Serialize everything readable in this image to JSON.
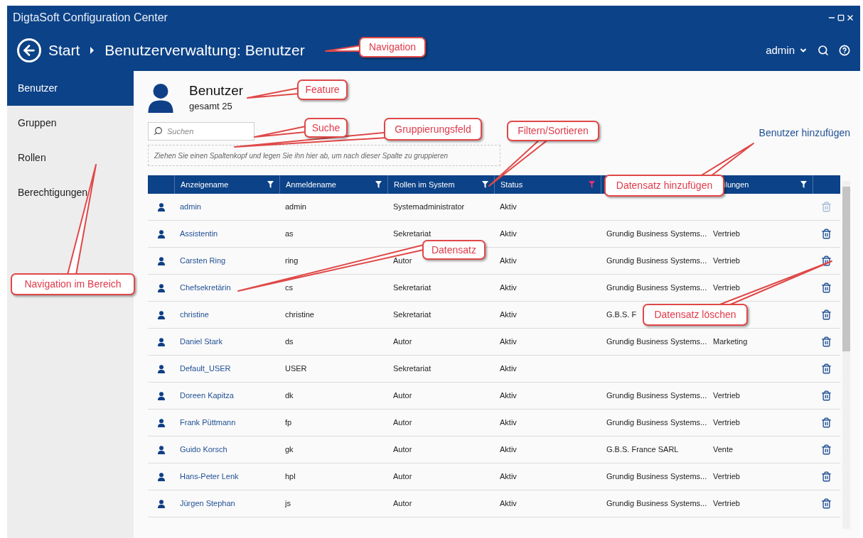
{
  "window": {
    "title": "DigtaSoft Configuration Center"
  },
  "breadcrumb": [
    "Start",
    "Benutzerverwaltung: Benutzer"
  ],
  "user_menu": {
    "label": "admin"
  },
  "sidebar": {
    "items": [
      {
        "label": "Benutzer",
        "selected": true
      },
      {
        "label": "Gruppen",
        "selected": false
      },
      {
        "label": "Rollen",
        "selected": false
      },
      {
        "label": "Berechtigungen",
        "selected": false
      }
    ]
  },
  "feature": {
    "title": "Benutzer",
    "subtitle": "gesamt 25"
  },
  "search": {
    "placeholder": "Suchen"
  },
  "add_link": "Benutzer hinzufügen",
  "group_area": {
    "placeholder": "Ziehen Sie einen Spaltenkopf und legen Sie ihn hier ab, um nach dieser Spalte zu gruppieren"
  },
  "table": {
    "columns": [
      {
        "label": "Anzeigename",
        "filter_active": false
      },
      {
        "label": "Anmeldename",
        "filter_active": false
      },
      {
        "label": "Rollen im System",
        "filter_active": false
      },
      {
        "label": "Status",
        "filter_active": true
      },
      {
        "kind": "covered"
      },
      {
        "label": "ilungen",
        "filter_active": false
      }
    ],
    "rows": [
      {
        "cells": [
          "admin",
          "admin",
          "Systemadministrator",
          "Aktiv",
          "",
          ""
        ],
        "deletable": false
      },
      {
        "cells": [
          "Assistentin",
          "as",
          "Sekretariat",
          "Aktiv",
          "Grundig Business Systems...",
          "Vertrieb"
        ],
        "deletable": true
      },
      {
        "cells": [
          "Carsten Ring",
          "ring",
          "Autor",
          "Aktiv",
          "Grundig Business Systems...",
          "Vertrieb"
        ],
        "deletable": true
      },
      {
        "cells": [
          "Chefsekretärin",
          "cs",
          "Sekretariat",
          "Aktiv",
          "Grundig Business Systems...",
          "Vertrieb"
        ],
        "deletable": true
      },
      {
        "cells": [
          "christine",
          "christine",
          "Sekretariat",
          "Aktiv",
          "G.B.S. F",
          ""
        ],
        "deletable": true
      },
      {
        "cells": [
          "Daniel Stark",
          "ds",
          "Autor",
          "Aktiv",
          "Grundig Business Systems...",
          "Marketing"
        ],
        "deletable": true
      },
      {
        "cells": [
          "Default_USER",
          "USER",
          "Sekretariat",
          "Aktiv",
          "",
          ""
        ],
        "deletable": true
      },
      {
        "cells": [
          "Doreen Kapitza",
          "dk",
          "Autor",
          "Aktiv",
          "Grundig Business Systems...",
          "Vertrieb"
        ],
        "deletable": true
      },
      {
        "cells": [
          "Frank Püttmann",
          "fp",
          "Autor",
          "Aktiv",
          "Grundig Business Systems...",
          "Vertrieb"
        ],
        "deletable": true
      },
      {
        "cells": [
          "Guido Korsch",
          "gk",
          "Autor",
          "Aktiv",
          "G.B.S. France SARL",
          "Vente"
        ],
        "deletable": true
      },
      {
        "cells": [
          "Hans-Peter Lenk",
          "hpl",
          "Autor",
          "Aktiv",
          "Grundig Business Systems...",
          "Vertrieb"
        ],
        "deletable": true
      },
      {
        "cells": [
          "Jürgen Stephan",
          "js",
          "Autor",
          "Aktiv",
          "Grundig Business Systems...",
          "Vertrieb"
        ],
        "deletable": true
      }
    ]
  },
  "annotations": [
    "Navigation",
    "Feature",
    "Suche",
    "Gruppierungsfeld",
    "Filtern/Sortieren",
    "Datensatz hinzufügen",
    "Datensatz",
    "Navigation im Bereich",
    "Datensatz löschen"
  ]
}
